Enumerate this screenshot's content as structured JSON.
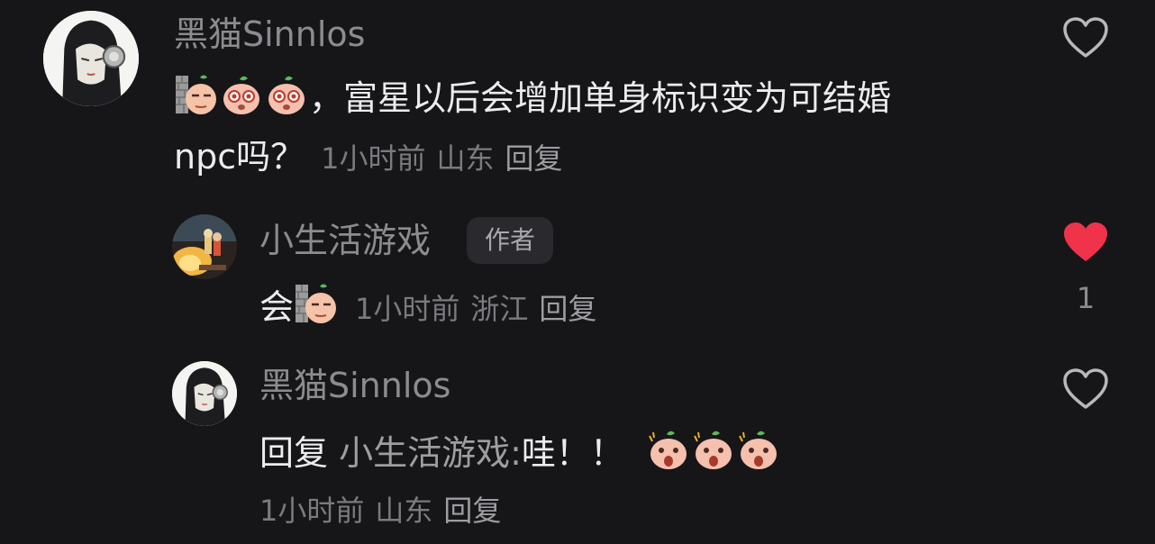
{
  "comments": [
    {
      "username": "黑猫Sinnlos",
      "text_line1": "，富星以后会增加单身标识变为可结婚",
      "text_line2": "npc吗？",
      "emojis": [
        "stoic-face-emoji",
        "starry-eyes-emoji",
        "starry-eyes-emoji"
      ],
      "time": "1小时前",
      "location": "山东",
      "reply_label": "回复",
      "liked": false
    },
    {
      "username": "小生活游戏",
      "badge": "作者",
      "text": "会",
      "emojis": [
        "stoic-face-emoji"
      ],
      "time": "1小时前",
      "location": "浙江",
      "reply_label": "回复",
      "liked": true,
      "like_count": "1"
    },
    {
      "username": "黑猫Sinnlos",
      "reply_prefix": "回复",
      "reply_target": "小生活游戏:",
      "text": "哇！！",
      "emojis": [
        "shocked-emoji",
        "shocked-emoji",
        "shocked-emoji"
      ],
      "time": "1小时前",
      "location": "山东",
      "reply_label": "回复",
      "liked": false
    }
  ],
  "colors": {
    "background": "#161619",
    "like_active": "#f0324a",
    "username": "#8c8c90",
    "text": "#ececef"
  }
}
